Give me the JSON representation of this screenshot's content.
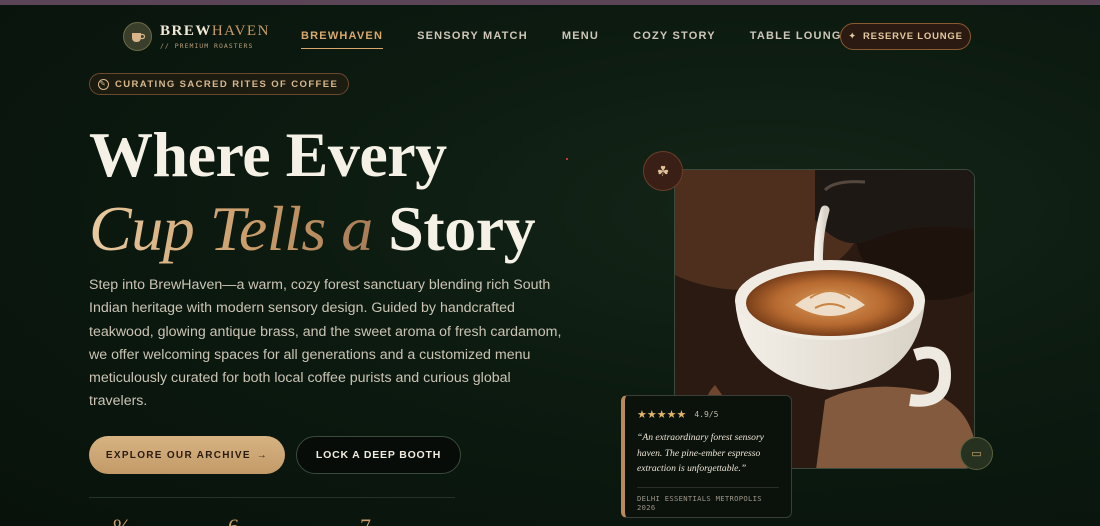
{
  "brand": {
    "name_part1": "BREW",
    "name_part2": "HAVEN",
    "subtitle": "// PREMIUM ROASTERS",
    "logo_icon": "coffee-cup-icon"
  },
  "nav": {
    "items": [
      {
        "label": "BREWHAVEN",
        "active": true
      },
      {
        "label": "SENSORY MATCH",
        "active": false
      },
      {
        "label": "MENU",
        "active": false
      },
      {
        "label": "COZY STORY",
        "active": false
      },
      {
        "label": "TABLE LOUNGE",
        "active": false
      }
    ],
    "reserve_label": "RESERVE LOUNGE",
    "reserve_icon": "sparkle-icon"
  },
  "hero": {
    "eyebrow": "CURATING SACRED RITES OF COFFEE",
    "headline_line1": "Where Every",
    "headline_italic": "Cup Tells a",
    "headline_end": "Story",
    "lead": "Step into BrewHaven—a warm, cozy forest sanctuary blending rich South Indian heritage with modern sensory design. Guided by handcrafted teakwood, glowing antique brass, and the sweet aroma of fresh cardamom, we offer welcoming spaces for all generations and a customized menu meticulously curated for both local coffee purists and curious global travelers.",
    "primary_cta": "EXPLORE OUR ARCHIVE",
    "primary_cta_arrow": "→",
    "secondary_cta": "LOCK A DEEP BOOTH"
  },
  "review": {
    "stars": "★★★★★",
    "rating": "4.9/5",
    "quote": "“An extraordinary forest sensory haven. The pine-ember espresso extraction is unforgettable.”",
    "source": "DELHI ESSENTIALS METROPOLIS 2026"
  },
  "colors": {
    "accent": "#c99c6a",
    "background": "#0c1a10",
    "brass": "#d7b382"
  }
}
